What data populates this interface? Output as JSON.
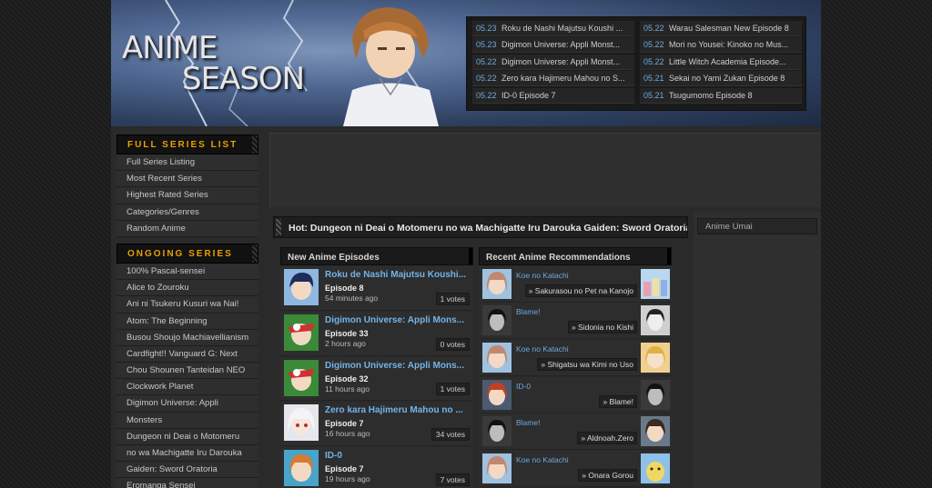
{
  "site": {
    "logo_line1": "ANIME",
    "logo_line2": "SEASON"
  },
  "latest": {
    "left": [
      {
        "date": "05.23",
        "title": "Roku de Nashi Majutsu Koushi ..."
      },
      {
        "date": "05.23",
        "title": "Digimon Universe: Appli Monst..."
      },
      {
        "date": "05.22",
        "title": "Digimon Universe: Appli Monst..."
      },
      {
        "date": "05.22",
        "title": "Zero kara Hajimeru Mahou no S..."
      },
      {
        "date": "05.22",
        "title": "ID-0 Episode 7"
      }
    ],
    "right": [
      {
        "date": "05.22",
        "title": "Warau Salesman New Episode 8"
      },
      {
        "date": "05.22",
        "title": "Mori no Yousei: Kinoko no Mus..."
      },
      {
        "date": "05.22",
        "title": "Little Witch Academia Episode..."
      },
      {
        "date": "05.21",
        "title": "Sekai no Yami Zukan Episode 8"
      },
      {
        "date": "05.21",
        "title": "Tsugumomo Episode 8"
      }
    ]
  },
  "sidebar": {
    "full_series_heading": "Full Series List",
    "full_series_items": [
      "Full Series Listing",
      "Most Recent Series",
      "Highest Rated Series",
      "Categories/Genres",
      "Random Anime"
    ],
    "ongoing_heading": "Ongoing Series",
    "ongoing_items": [
      "100% Pascal-sensei",
      "Alice to Zouroku",
      "Ani ni Tsukeru Kusuri wa Nai!",
      "Atom: The Beginning",
      "Busou Shoujo Machiavellianism",
      "Cardfight!! Vanguard G: Next",
      "Chou Shounen Tanteidan NEO",
      "Clockwork Planet",
      "Digimon Universe: Appli",
      "Monsters",
      "Dungeon ni Deai o Motomeru",
      "no wa Machigatte Iru Darouka",
      "Gaiden: Sword Oratoria",
      "Eromanga Sensei"
    ]
  },
  "hot": {
    "text": "Hot: Dungeon ni Deai o Motomeru no wa Machigatte Iru Darouka Gaiden: Sword Oratoria"
  },
  "right_sidebar": {
    "item": "Anime Umai"
  },
  "episodes": {
    "heading": "New Anime Episodes",
    "items": [
      {
        "title": "Roku de Nashi Majutsu Koushi...",
        "episode": "Episode 8",
        "time": "54 minutes ago",
        "votes": "1 votes"
      },
      {
        "title": "Digimon Universe: Appli Mons...",
        "episode": "Episode 33",
        "time": "2 hours ago",
        "votes": "0 votes"
      },
      {
        "title": "Digimon Universe: Appli Mons...",
        "episode": "Episode 32",
        "time": "11 hours ago",
        "votes": "1 votes"
      },
      {
        "title": "Zero kara Hajimeru Mahou no ...",
        "episode": "Episode 7",
        "time": "16 hours ago",
        "votes": "34 votes"
      },
      {
        "title": "ID-0",
        "episode": "Episode 7",
        "time": "19 hours ago",
        "votes": "7 votes"
      }
    ]
  },
  "recommendations": {
    "heading": "Recent Anime Recommendations",
    "items": [
      {
        "from": "Koe no Katachi",
        "to": "» Sakurasou no Pet na Kanojo"
      },
      {
        "from": "Blame!",
        "to": "» Sidonia no Kishi"
      },
      {
        "from": "Koe no Katachi",
        "to": "» Shigatsu wa Kimi no Uso"
      },
      {
        "from": "ID-0",
        "to": "» Blame!"
      },
      {
        "from": "Blame!",
        "to": "» Aldnoah.Zero"
      },
      {
        "from": "Koe no Katachi",
        "to": "» Onara Gorou"
      }
    ]
  },
  "colors": {
    "accent_orange": "#e8a000",
    "link_blue": "#73b4e8",
    "date_blue": "#6fa8dc"
  }
}
